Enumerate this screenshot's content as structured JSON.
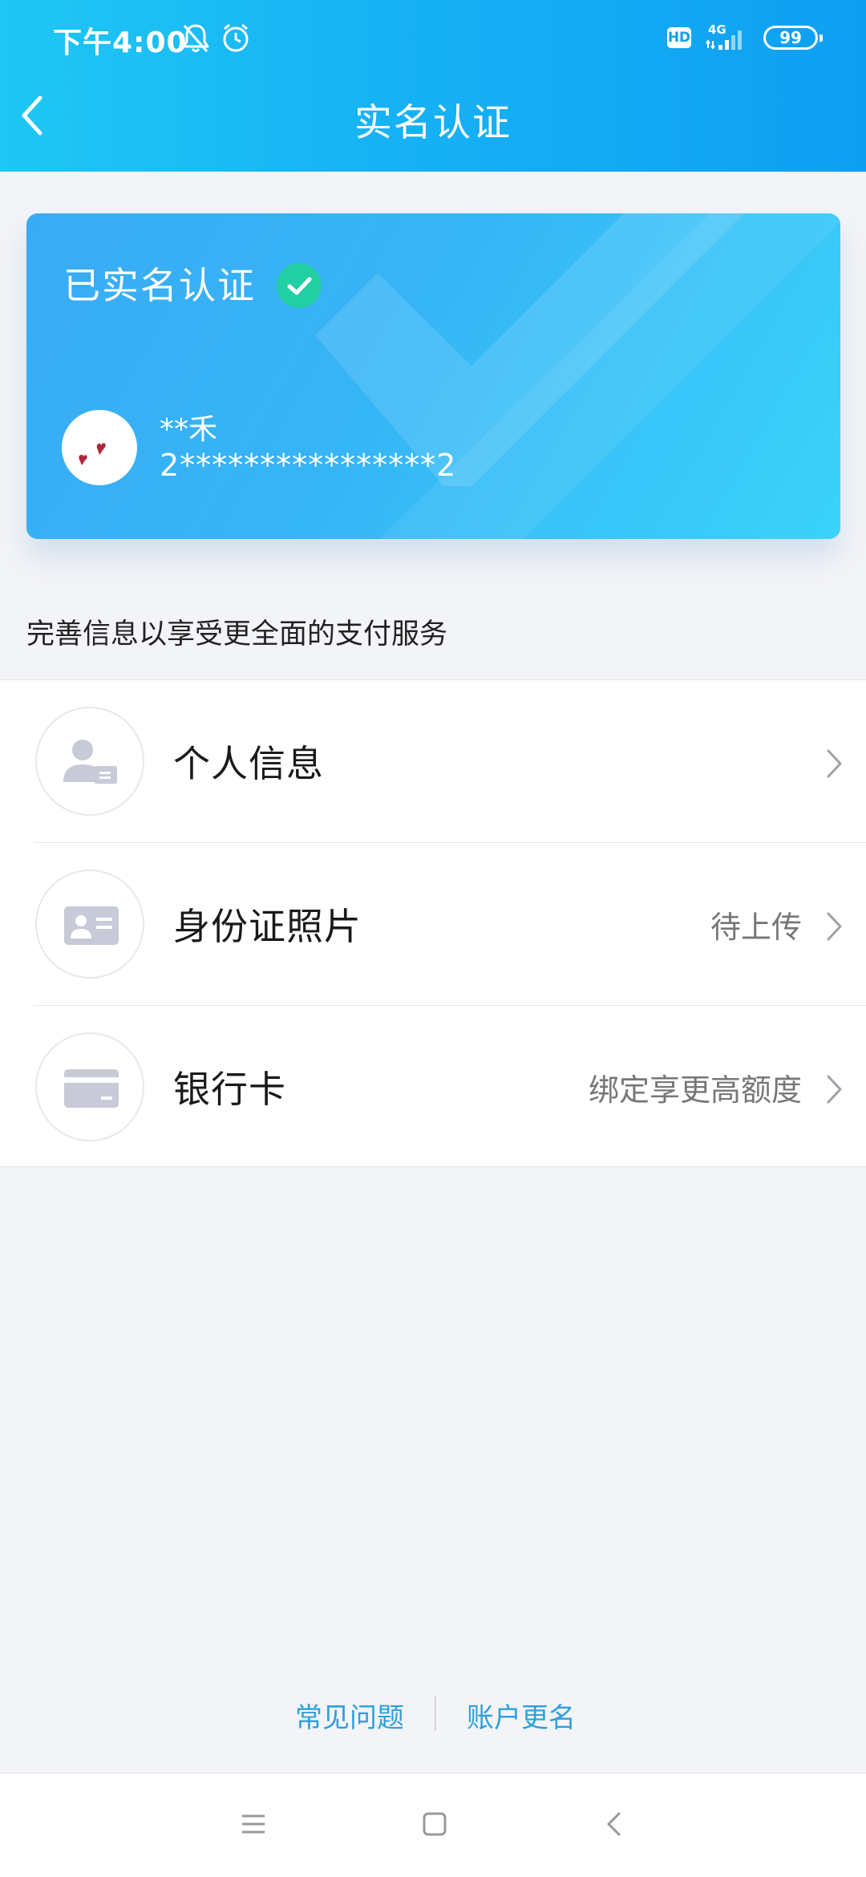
{
  "status_bar": {
    "time": "下午4:00",
    "hd_label": "HD",
    "network_label": "4G",
    "battery_level": "99"
  },
  "header": {
    "title": "实名认证"
  },
  "verify_card": {
    "status_label": "已实名认证",
    "user_name": "**禾",
    "id_number": "2****************2"
  },
  "info_prompt": "完善信息以享受更全面的支付服务",
  "list_items": [
    {
      "label": "个人信息",
      "status": "",
      "icon": "personal-info-icon"
    },
    {
      "label": "身份证照片",
      "status": "待上传",
      "icon": "id-card-icon"
    },
    {
      "label": "银行卡",
      "status": "绑定享更高额度",
      "icon": "bank-card-icon"
    }
  ],
  "footer": {
    "faq_label": "常见问题",
    "rename_label": "账户更名"
  },
  "colors": {
    "header_gradient": [
      "#1fc7f4",
      "#0e9ff2"
    ],
    "card_gradient": [
      "#39abf4",
      "#3ad3f9"
    ],
    "verified_badge": "#22cfa3",
    "link": "#2f9fdc"
  }
}
